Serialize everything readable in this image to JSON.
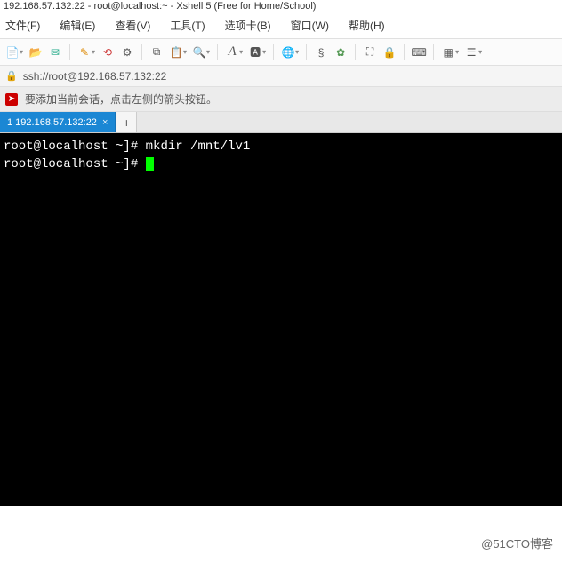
{
  "title": "192.168.57.132:22 - root@localhost:~ - Xshell 5 (Free for Home/School)",
  "menu": [
    "文件(F)",
    "编辑(E)",
    "查看(V)",
    "工具(T)",
    "选项卡(B)",
    "窗口(W)",
    "帮助(H)"
  ],
  "toolbar_icons": [
    "document-icon",
    "chevron-icon",
    "open-icon",
    "send-icon",
    "sep",
    "pencil-icon",
    "scissors-icon",
    "keyboard-icon",
    "sep",
    "refresh-icon",
    "stamp-icon",
    "box-icon",
    "sep",
    "font-a-icon",
    "fontset-icon",
    "sep",
    "globe-icon",
    "sep",
    "swirl-icon",
    "leaf-icon",
    "sep",
    "expand-icon",
    "lock-icon",
    "sep",
    "keyboard2-icon",
    "sep",
    "layout-icon",
    "list-icon"
  ],
  "addressbar": {
    "url": "ssh://root@192.168.57.132:22"
  },
  "hint": {
    "text": "要添加当前会话，点击左侧的箭头按钮。"
  },
  "tabs": [
    {
      "label": "1 192.168.57.132:22",
      "active": true
    }
  ],
  "terminal": {
    "lines": [
      {
        "prompt": "root@localhost ~]# ",
        "cmd": "mkdir /mnt/lv1"
      },
      {
        "prompt": "root@localhost ~]# ",
        "cmd": ""
      }
    ]
  },
  "watermark": "@51CTO博客"
}
